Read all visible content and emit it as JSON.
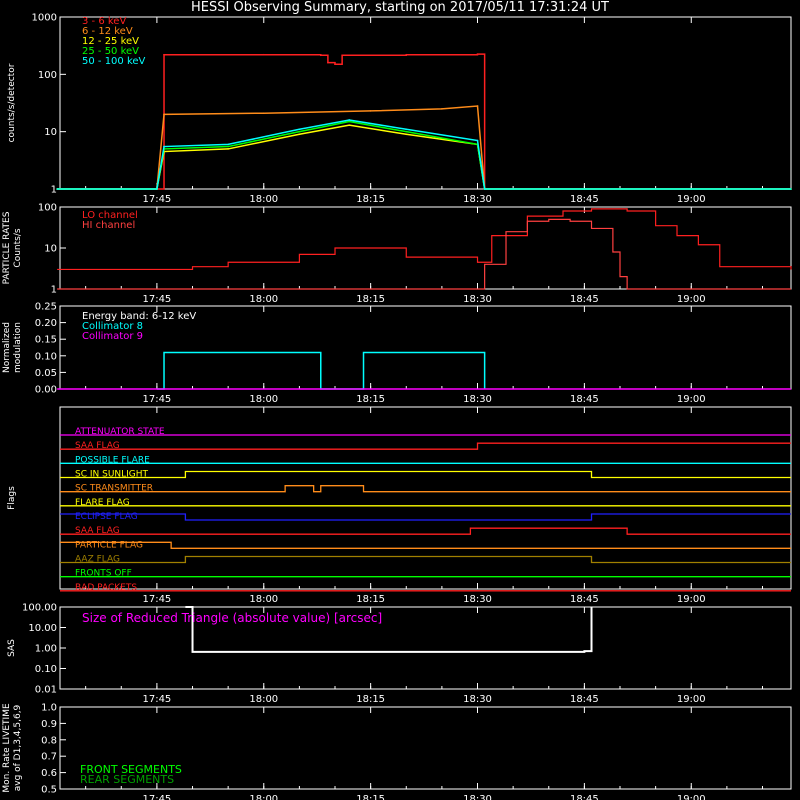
{
  "title": "HESSI Observing Summary, starting on 2017/05/11 17:31:24 UT",
  "time_ticks": [
    "17:45",
    "18:00",
    "18:15",
    "18:30",
    "18:45",
    "19:00"
  ],
  "colors": {
    "background": "#000000",
    "axes": "#ffffff",
    "red": "#ff2020",
    "orange": "#ff8c1a",
    "yellow": "#ffff00",
    "green": "#00ff00",
    "cyan": "#00ffff",
    "magenta": "#ff00ff",
    "blue": "#2020ff",
    "gold": "#e0c000",
    "olive": "#a08000",
    "darkgreen": "#00a000"
  },
  "chart_data": [
    {
      "type": "line",
      "panel": "count-rates",
      "ylabel": "counts/s/detector",
      "yscale": "log",
      "ylim": [
        1,
        1000
      ],
      "yticks": [
        "1",
        "10",
        "100",
        "1000"
      ],
      "x_range": [
        "17:31:24",
        "19:14"
      ],
      "series": [
        {
          "name": "3 - 6 keV",
          "color": "#ff2020",
          "x": [
            "17:31",
            "17:45",
            "17:46",
            "18:00",
            "18:08",
            "18:09",
            "18:10",
            "18:11",
            "18:20",
            "18:30",
            "18:31",
            "19:14"
          ],
          "y": [
            1,
            1,
            220,
            220,
            215,
            160,
            150,
            215,
            220,
            225,
            1,
            1
          ]
        },
        {
          "name": "6 - 12 keV",
          "color": "#ff8c1a",
          "x": [
            "17:31",
            "17:45",
            "17:46",
            "18:00",
            "18:15",
            "18:25",
            "18:30",
            "18:31",
            "19:14"
          ],
          "y": [
            1,
            1,
            20,
            21,
            23,
            25,
            28,
            1,
            1
          ]
        },
        {
          "name": "12 - 25 keV",
          "color": "#ffff00",
          "x": [
            "17:31",
            "17:45",
            "17:46",
            "17:55",
            "18:05",
            "18:12",
            "18:20",
            "18:30",
            "18:31",
            "19:14"
          ],
          "y": [
            1,
            1,
            4.5,
            5,
            9,
            13,
            9,
            6,
            1,
            1
          ]
        },
        {
          "name": "25 - 50 keV",
          "color": "#00ff00",
          "x": [
            "17:31",
            "17:45",
            "17:46",
            "17:55",
            "18:05",
            "18:12",
            "18:20",
            "18:30",
            "18:31",
            "19:14"
          ],
          "y": [
            1,
            1,
            5,
            5.5,
            10,
            15,
            10,
            6,
            1,
            1
          ]
        },
        {
          "name": "50 - 100 keV",
          "color": "#00ffff",
          "x": [
            "17:31",
            "17:45",
            "17:46",
            "17:55",
            "18:05",
            "18:12",
            "18:20",
            "18:30",
            "18:31",
            "19:14"
          ],
          "y": [
            1,
            1,
            5.5,
            6,
            11,
            16,
            11,
            7,
            1,
            1
          ]
        }
      ]
    },
    {
      "type": "line",
      "panel": "particle-rates",
      "ylabel": "PARTICLE RATES Counts/s",
      "yscale": "log",
      "ylim": [
        1,
        100
      ],
      "yticks": [
        "1",
        "10",
        "100"
      ],
      "series": [
        {
          "name": "LO channel",
          "color": "#ff2020",
          "x": [
            "17:31",
            "17:40",
            "17:50",
            "17:55",
            "18:05",
            "18:10",
            "18:13",
            "18:20",
            "18:30",
            "18:32",
            "18:37",
            "18:42",
            "18:46",
            "18:51",
            "18:55",
            "18:58",
            "19:01",
            "19:04",
            "19:14"
          ],
          "y": [
            3,
            3,
            3.5,
            4.5,
            7,
            10,
            10,
            6,
            4.5,
            20,
            60,
            80,
            90,
            80,
            35,
            20,
            12,
            3.5,
            3
          ]
        },
        {
          "name": "HI channel",
          "color": "#ff4040",
          "x": [
            "17:31",
            "18:30",
            "18:31",
            "18:34",
            "18:37",
            "18:40",
            "18:43",
            "18:46",
            "18:49",
            "18:50",
            "18:51",
            "19:14"
          ],
          "y": [
            1,
            1,
            4,
            25,
            45,
            50,
            45,
            30,
            8,
            2,
            1,
            1
          ]
        }
      ]
    },
    {
      "type": "line",
      "panel": "modulation",
      "ylabel": "Normalized modulation",
      "ylim": [
        0,
        0.25
      ],
      "yticks": [
        "0.00",
        "0.05",
        "0.10",
        "0.15",
        "0.20",
        "0.25"
      ],
      "annotation": "Energy band: 6-12 keV",
      "series": [
        {
          "name": "Collimator 8",
          "color": "#00ffff",
          "x": [
            "17:45",
            "17:46",
            "18:07",
            "18:08",
            "18:13",
            "18:14",
            "18:30",
            "18:31"
          ],
          "y": [
            0,
            0.11,
            0.11,
            0,
            0,
            0.11,
            0.11,
            0
          ]
        },
        {
          "name": "Collimator 9",
          "color": "#ff00ff",
          "x": [
            "17:31",
            "19:14"
          ],
          "y": [
            0,
            0
          ]
        }
      ]
    },
    {
      "type": "line",
      "panel": "flags",
      "ylabel": "Flags",
      "series": [
        {
          "name": "ATTENUATOR STATE",
          "color": "#ff00ff",
          "x": [
            "17:31",
            "19:14"
          ],
          "state": [
            0,
            0
          ]
        },
        {
          "name": "SAA FLAG",
          "color": "#ff2020",
          "x": [
            "17:31",
            "18:30",
            "19:14"
          ],
          "state": [
            0,
            1,
            1
          ]
        },
        {
          "name": "POSSIBLE FLARE",
          "color": "#00ffff",
          "x": [
            "17:31",
            "19:14"
          ],
          "state": [
            0,
            0
          ]
        },
        {
          "name": "SC IN SUNLIGHT",
          "color": "#ffff00",
          "x": [
            "17:31",
            "17:49",
            "18:46",
            "19:14"
          ],
          "state": [
            0,
            1,
            0,
            0
          ]
        },
        {
          "name": "SC TRANSMITTER",
          "color": "#ff8c1a",
          "x": [
            "17:31",
            "18:03",
            "18:07",
            "18:08",
            "18:14",
            "19:14"
          ],
          "state": [
            0,
            1,
            0,
            1,
            0,
            0
          ]
        },
        {
          "name": "FLARE FLAG",
          "color": "#ffff00",
          "x": [
            "17:31",
            "19:14"
          ],
          "state": [
            0,
            0
          ]
        },
        {
          "name": "ECLIPSE FLAG",
          "color": "#2020ff",
          "x": [
            "17:31",
            "17:49",
            "18:46",
            "19:14"
          ],
          "state": [
            1,
            0,
            1,
            1
          ]
        },
        {
          "name": "SAA FLAG",
          "color": "#ff2020",
          "x": [
            "17:31",
            "18:29",
            "18:51",
            "19:14"
          ],
          "state": [
            0,
            1,
            0,
            0
          ]
        },
        {
          "name": "PARTICLE FLAG",
          "color": "#ff8c1a",
          "x": [
            "17:31",
            "17:47",
            "19:14"
          ],
          "state": [
            1,
            0,
            0
          ]
        },
        {
          "name": "AAZ FLAG",
          "color": "#a08000",
          "x": [
            "17:31",
            "17:49",
            "18:46",
            "19:14"
          ],
          "state": [
            0,
            1,
            0,
            0
          ]
        },
        {
          "name": "FRONTS OFF",
          "color": "#00ff00",
          "x": [
            "17:31",
            "19:14"
          ],
          "state": [
            0,
            0
          ]
        },
        {
          "name": "BAD PACKETS",
          "color": "#ff2020",
          "x": [
            "17:31",
            "19:14"
          ],
          "state": [
            0,
            0
          ]
        }
      ]
    },
    {
      "type": "line",
      "panel": "sas",
      "ylabel": "SAS",
      "yscale": "log",
      "ylim": [
        0.01,
        100
      ],
      "yticks": [
        "0.01",
        "0.10",
        "1.00",
        "10.00",
        "100.00"
      ],
      "title": "Size of Reduced Triangle (absolute value) [arcsec]",
      "series": [
        {
          "name": "Size of Reduced Triangle",
          "color": "#ffffff",
          "x": [
            "17:49",
            "17:50",
            "18:45",
            "18:46"
          ],
          "y": [
            100,
            0.65,
            0.7,
            100
          ]
        }
      ]
    },
    {
      "type": "line",
      "panel": "livetime",
      "ylabel": "Mon. Rate LIVETIME avg of D1,3,4,5,6,9",
      "ylim": [
        0.5,
        1.0
      ],
      "yticks": [
        "0.5",
        "0.6",
        "0.7",
        "0.8",
        "0.9",
        "1.0"
      ],
      "series": [
        {
          "name": "FRONT SEGMENTS",
          "color": "#00ff00",
          "x": [],
          "y": []
        },
        {
          "name": "REAR SEGMENTS",
          "color": "#00a000",
          "x": [],
          "y": []
        }
      ]
    }
  ]
}
